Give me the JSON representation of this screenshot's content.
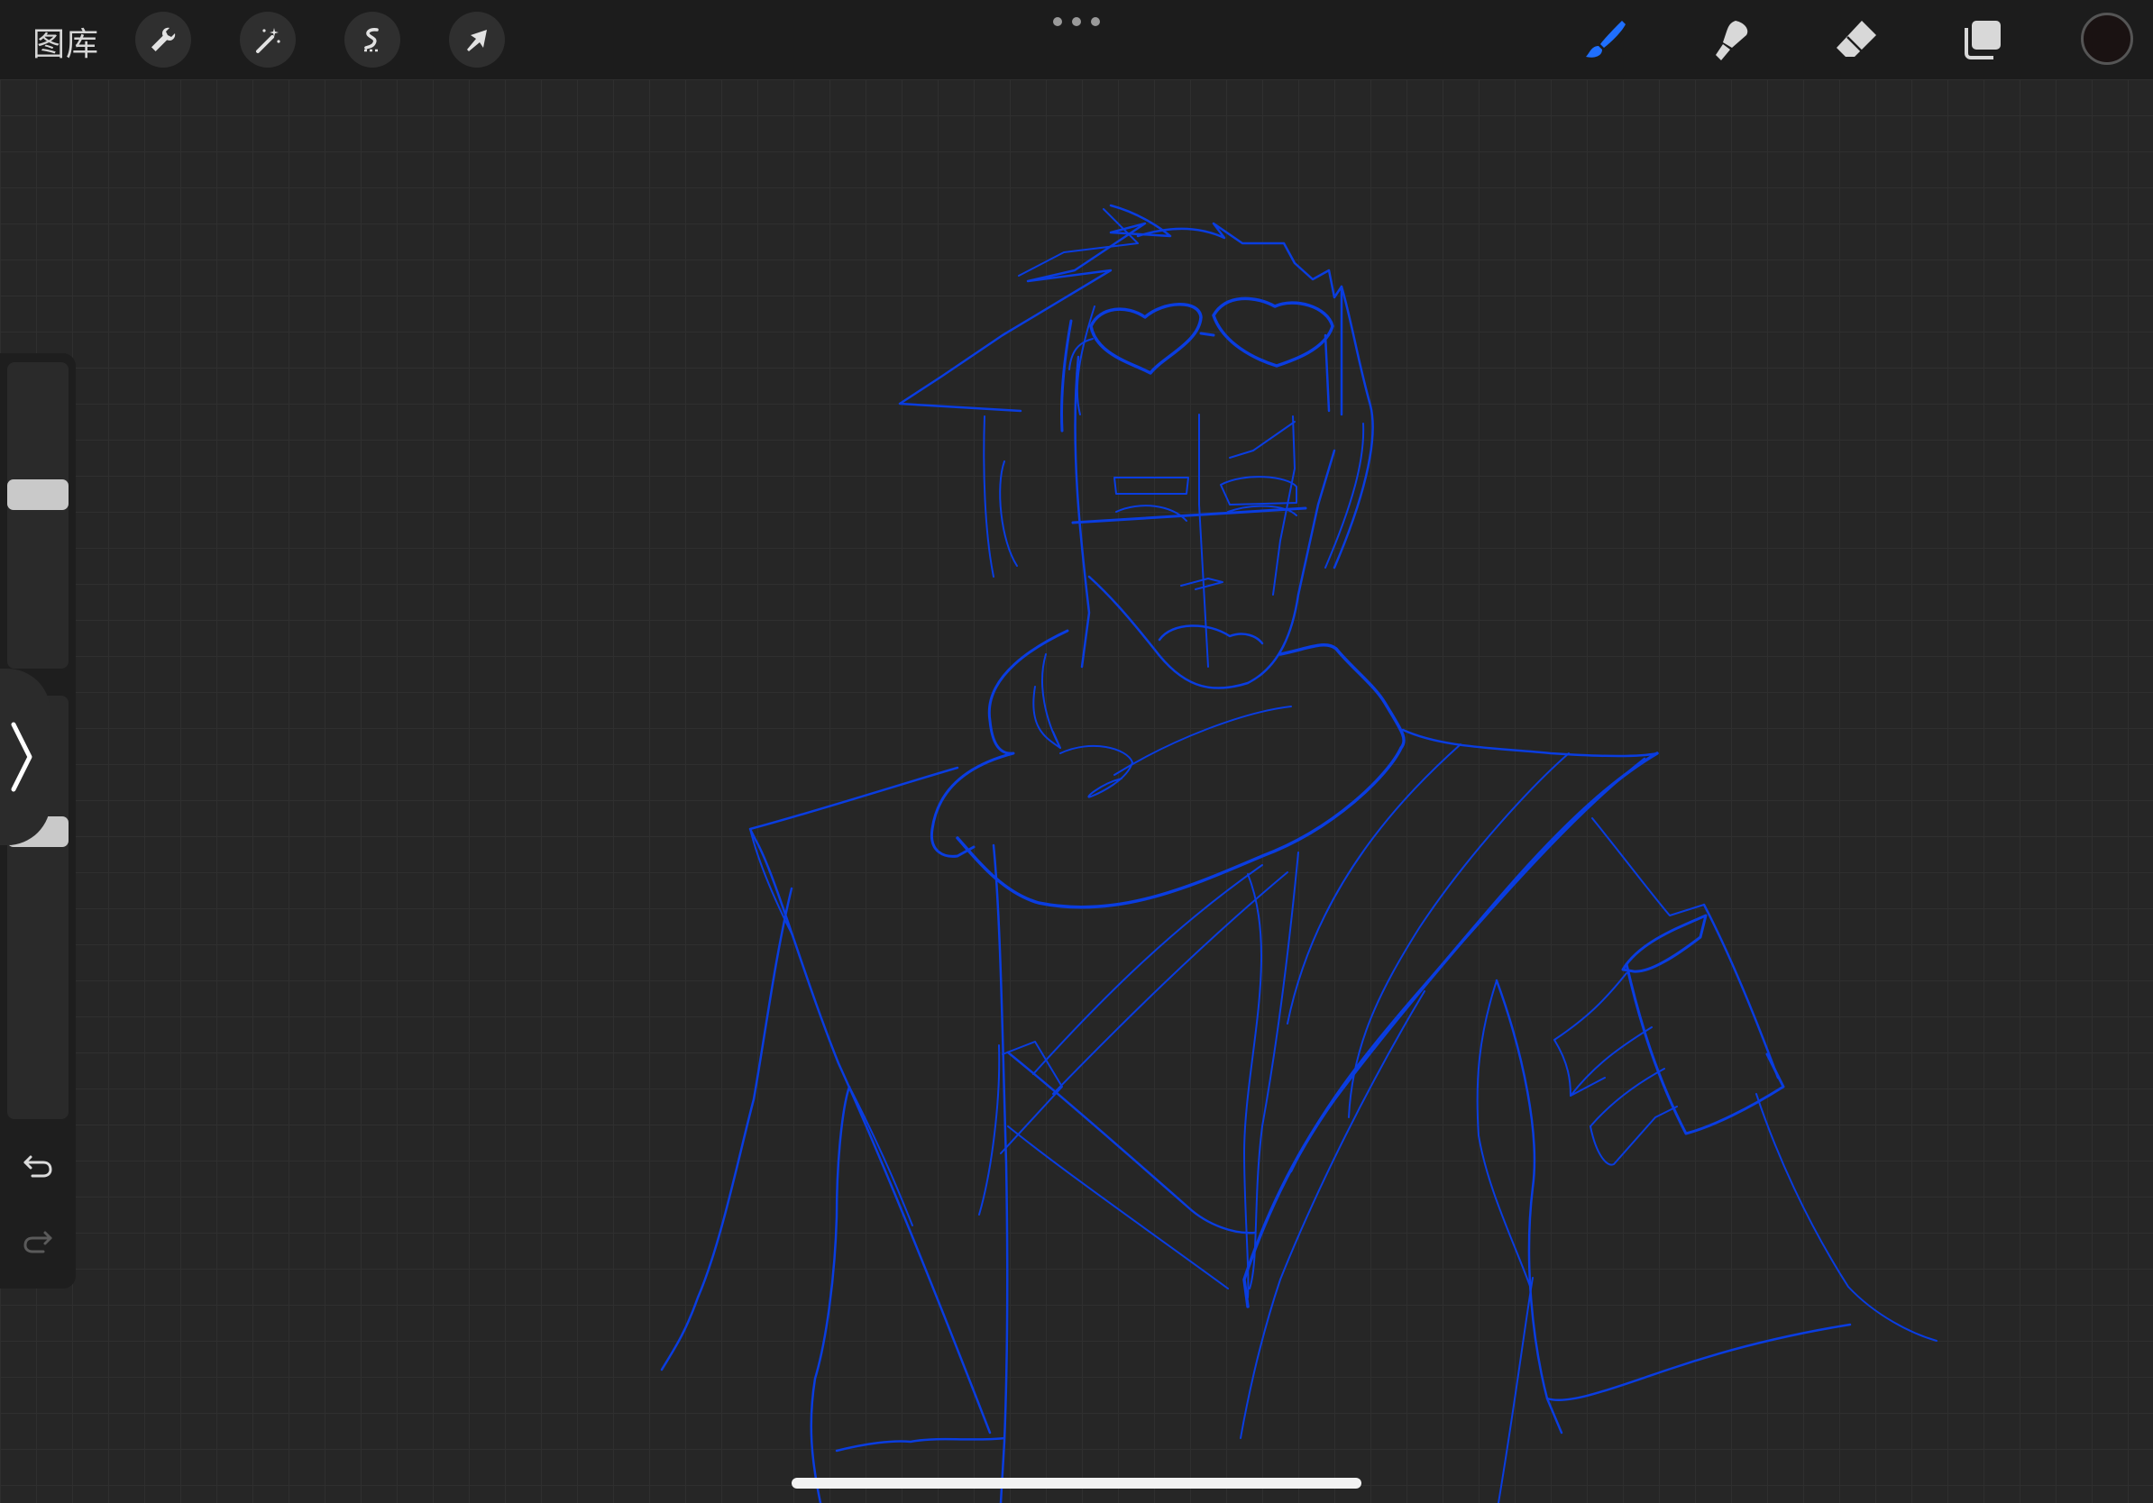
{
  "topbar": {
    "gallery_label": "图库",
    "left_tools": [
      {
        "icon": "wrench-icon",
        "name": "actions"
      },
      {
        "icon": "magic-wand-icon",
        "name": "adjustments"
      },
      {
        "icon": "selection-icon",
        "name": "selection"
      },
      {
        "icon": "arrow-cursor-icon",
        "name": "transform"
      }
    ],
    "more_menu_icon": "more-dots-icon",
    "right_tools": [
      {
        "icon": "brush-icon",
        "name": "paint",
        "active": true
      },
      {
        "icon": "smudge-icon",
        "name": "smudge",
        "active": false
      },
      {
        "icon": "eraser-icon",
        "name": "erase",
        "active": false
      },
      {
        "icon": "layers-icon",
        "name": "layers",
        "active": false
      }
    ],
    "current_color": "#1a1212"
  },
  "sidebar": {
    "brush_size_icon": "brush-size-slider",
    "brush_opacity_icon": "brush-opacity-slider",
    "modify_button_icon": "modify-button",
    "undo_icon": "undo-icon",
    "redo_icon": "redo-icon",
    "redo_enabled": false,
    "collapse_tab_icon": "chevron-right-icon"
  },
  "canvas": {
    "stroke_color": "#0a3de0",
    "background": "#262626",
    "grid_color": "#2f2f2f"
  },
  "colors": {
    "accent_active_tool": "#1f6fff",
    "inactive_tool": "#d8d8d8",
    "topbar": "#1c1c1c",
    "sidebar": "#1e1e1e"
  }
}
